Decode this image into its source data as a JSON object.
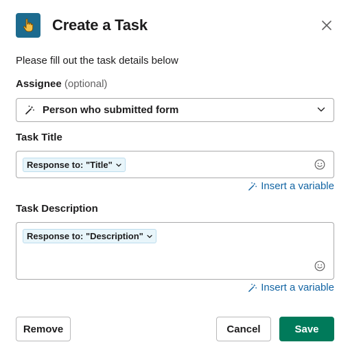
{
  "dialog": {
    "title": "Create a Task",
    "intro": "Please fill out the task details below",
    "app_icon": "pointing-hand-icon",
    "accent_color": "#1d6b8f"
  },
  "assignee": {
    "label": "Assignee",
    "optional": "(optional)",
    "value": "Person who submitted form",
    "icon": "magic-wand-icon"
  },
  "task_title": {
    "label": "Task Title",
    "token": "Response to: \"Title\"",
    "insert_variable": "Insert a variable"
  },
  "task_description": {
    "label": "Task Description",
    "token": "Response to: \"Description\"",
    "insert_variable": "Insert a variable"
  },
  "buttons": {
    "remove": "Remove",
    "cancel": "Cancel",
    "save": "Save",
    "save_color": "#007a5a",
    "link_color": "#1264a3"
  }
}
